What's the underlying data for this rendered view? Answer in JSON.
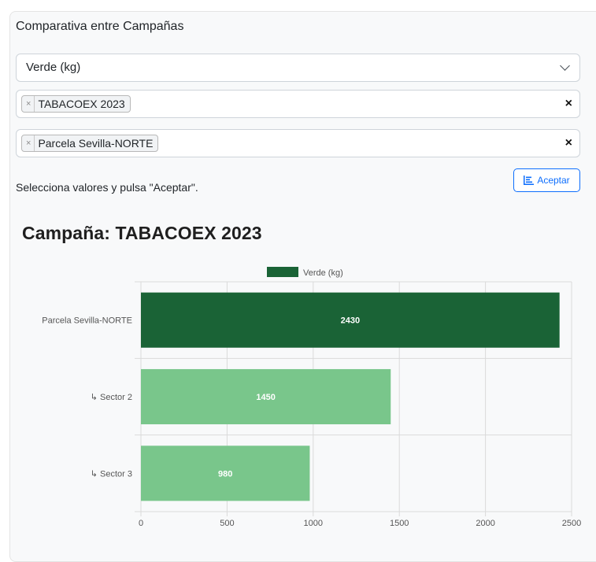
{
  "panel": {
    "title": "Comparativa entre Campañas"
  },
  "metric_select": {
    "value": "Verde (kg)"
  },
  "campaign_select": {
    "chip": "TABACOEX 2023",
    "remove_symbol": "×",
    "clear_symbol": "×"
  },
  "parcel_select": {
    "chip": "Parcela Sevilla-NORTE",
    "remove_symbol": "×",
    "clear_symbol": "×"
  },
  "hint": "Selecciona valores y pulsa \"Aceptar\".",
  "accept_button": {
    "label": "Aceptar"
  },
  "chart_title": "Campaña: TABACOEX 2023",
  "chart_data": {
    "type": "bar",
    "orientation": "horizontal",
    "categories": [
      "Parcela Sevilla-NORTE",
      "↳ Sector 2",
      "↳ Sector 3"
    ],
    "series": [
      {
        "name": "Verde (kg)",
        "values": [
          2430,
          1450,
          980
        ]
      }
    ],
    "data_labels": [
      "2430",
      "1450",
      "980"
    ],
    "bar_colors": [
      "#1a6336",
      "#79c68b",
      "#79c68b"
    ],
    "legend_color": "#1a6336",
    "x_ticks": [
      0,
      500,
      1000,
      1500,
      2000,
      2500
    ],
    "xlim": [
      0,
      2500
    ],
    "grid": true,
    "legend_position": "top"
  }
}
